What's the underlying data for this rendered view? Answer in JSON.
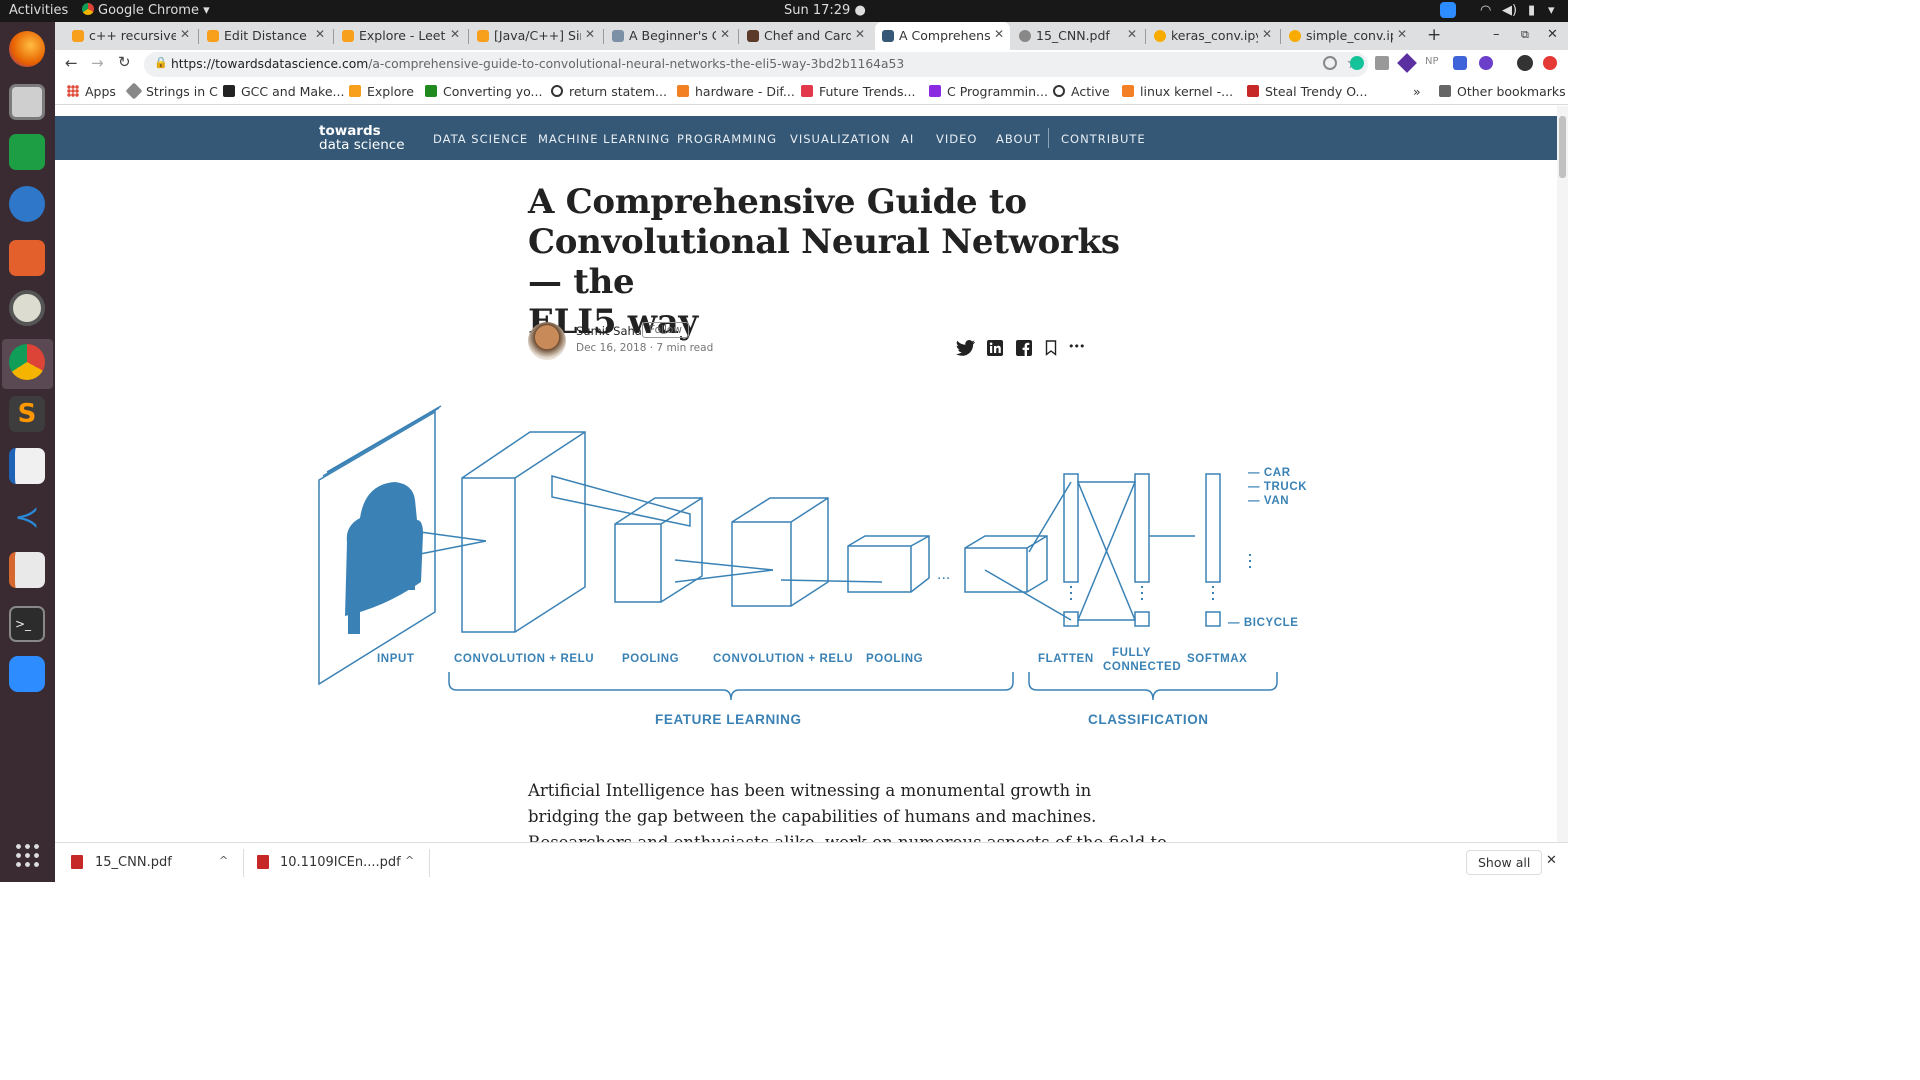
{
  "os": {
    "activities": "Activities",
    "app_name": "Google Chrome",
    "clock": "Sun 17:29"
  },
  "tabs": [
    {
      "title": "c++ recursive",
      "active": false
    },
    {
      "title": "Edit Distance",
      "active": false
    },
    {
      "title": "Explore - LeetC",
      "active": false
    },
    {
      "title": "[Java/C++] Sim",
      "active": false
    },
    {
      "title": "A Beginner's G",
      "active": false
    },
    {
      "title": "Chef and Card",
      "active": false
    },
    {
      "title": "A Comprehens",
      "active": true
    },
    {
      "title": "15_CNN.pdf",
      "active": false
    },
    {
      "title": "keras_conv.ipy",
      "active": false
    },
    {
      "title": "simple_conv.ip",
      "active": false
    }
  ],
  "url": {
    "domain": "https://towardsdatascience.com",
    "path": "/a-comprehensive-guide-to-convolutional-neural-networks-the-eli5-way-3bd2b1164a53"
  },
  "bookmarks": {
    "items": [
      "Apps",
      "Strings in C",
      "GCC and Make...",
      "Explore",
      "Converting yo...",
      "return statem...",
      "hardware - Dif...",
      "Future Trends...",
      "C Programmin...",
      "Active",
      "linux kernel -...",
      "Steal Trendy O..."
    ],
    "overflow": "»",
    "other": "Other bookmarks"
  },
  "site": {
    "logo_line1": "towards",
    "logo_line2": "data science",
    "nav": [
      "DATA SCIENCE",
      "MACHINE LEARNING",
      "PROGRAMMING",
      "VISUALIZATION",
      "AI",
      "VIDEO",
      "ABOUT",
      "CONTRIBUTE"
    ]
  },
  "article": {
    "title_lines": [
      "A Comprehensive Guide to",
      "Convolutional Neural Networks — the",
      "ELI5 way"
    ],
    "author": "Sumit Saha",
    "follow": "Follow",
    "meta": "Dec 16, 2018 · 7 min read",
    "share_more": "•••",
    "body_line1": "Artificial Intelligence has been witnessing a monumental growth in",
    "body_line2": "bridging the gap between the capabilities of humans and machines.",
    "body_line3": "Researchers and enthusiasts alike, work on numerous aspects of the field to"
  },
  "figure": {
    "stage_labels": [
      "INPUT",
      "CONVOLUTION + RELU",
      "POOLING",
      "CONVOLUTION + RELU",
      "POOLING",
      "FLATTEN",
      "FULLY",
      "CONNECTED",
      "SOFTMAX"
    ],
    "group_labels": [
      "FEATURE LEARNING",
      "CLASSIFICATION"
    ],
    "outputs": [
      "CAR",
      "TRUCK",
      "VAN",
      "BICYCLE"
    ],
    "color": "#3a82b5"
  },
  "downloads": {
    "items": [
      "15_CNN.pdf",
      "10.1109ICEn....pdf"
    ],
    "show_all": "Show all"
  },
  "colors": {
    "nav_bg": "#355876",
    "dock_bg": "#3a2b33",
    "accent": "#3a82b5"
  }
}
